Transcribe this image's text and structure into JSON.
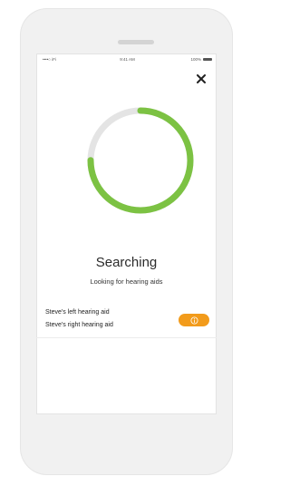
{
  "status_bar": {
    "carrier": "••••○ iFi",
    "time": "9:41 AM",
    "battery": "100%"
  },
  "search": {
    "title": "Searching",
    "subtitle": "Looking for hearing aids",
    "progress_fraction": 0.75
  },
  "devices": [
    {
      "label": "Steve's left hearing aid"
    },
    {
      "label": "Steve's right hearing aid"
    }
  ],
  "colors": {
    "progress_green": "#7cc243",
    "status_orange": "#f29b1b"
  },
  "icons": {
    "close": "close-icon",
    "info": "info-icon"
  }
}
